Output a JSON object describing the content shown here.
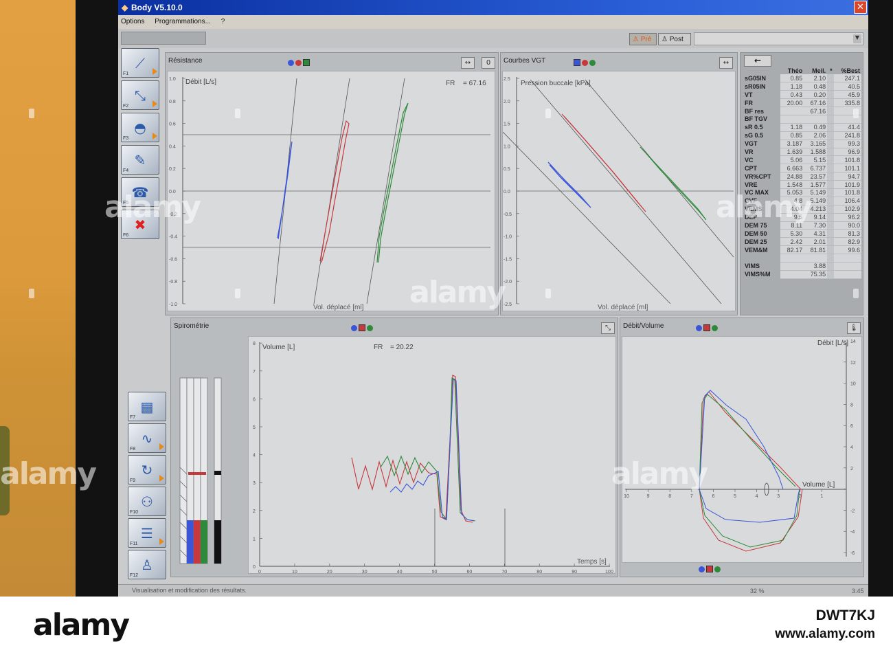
{
  "window": {
    "title": "Body V5.10.0"
  },
  "menu": [
    "Options",
    "Programmations...",
    "?"
  ],
  "toolbar": {
    "pre_label": "Pré",
    "post_label": "Post"
  },
  "fkeys_top": [
    "F1",
    "F2",
    "F3",
    "F4",
    "F5",
    "F6"
  ],
  "fkeys_bottom": [
    "F7",
    "F8",
    "F9",
    "F10",
    "F11",
    "F12"
  ],
  "fkey_icons": [
    "resistance-loop-icon",
    "vgt-curve-icon",
    "flow-volume-icon",
    "asc-icon",
    "phone-icon",
    "tools-cancel-icon",
    "calculator-icon",
    "sine-wave-icon",
    "repeat-cycle-icon",
    "graph-points-icon",
    "report-list-icon",
    "person-tools-icon"
  ],
  "resistance": {
    "title": "Résistance",
    "ylabel": "Débit [L/s]",
    "xlabel": "Vol. déplacé [ml]",
    "fr_label": "FR",
    "fr_value": "= 67.16",
    "yticks": [
      "1.0",
      "0.8",
      "0.6",
      "0.4",
      "0.2",
      "0.0",
      "-0.2",
      "-0.4",
      "-0.6",
      "-0.8",
      "-1.0"
    ]
  },
  "vgt": {
    "title": "Courbes VGT",
    "ylabel": "Pression buccale [kPa]",
    "xlabel": "Vol. déplacé [ml]",
    "yticks": [
      "2.5",
      "2.0",
      "1.5",
      "1.0",
      "0.5",
      "0.0",
      "-0.5",
      "-1.0",
      "-1.5",
      "-2.0",
      "-2.5"
    ]
  },
  "spirometry": {
    "title": "Spirométrie",
    "ylabel": "Volume [L]",
    "xlabel": "Temps [s]",
    "fr_label": "FR",
    "fr_value": "= 20.22",
    "yticks": [
      "0",
      "1",
      "2",
      "3",
      "4",
      "5",
      "6",
      "7",
      "8",
      "9"
    ],
    "xticks": [
      "0",
      "10",
      "20",
      "30",
      "40",
      "50",
      "60",
      "70",
      "80",
      "90",
      "100"
    ]
  },
  "flow_volume": {
    "title": "Débit/Volume",
    "ylabel": "Débit [L/s]",
    "xlabel": "Volume [L]",
    "yticks": [
      "14",
      "12",
      "10",
      "8",
      "6",
      "4",
      "2",
      "",
      "-2",
      "-4",
      "-6"
    ],
    "xticks": [
      "10",
      "9",
      "8",
      "7",
      "6",
      "5",
      "4",
      "3",
      "2",
      "1"
    ]
  },
  "results": {
    "headers": [
      "",
      "Théo",
      "Meil.",
      "*",
      "%Best"
    ],
    "rows": [
      [
        "sG05IN",
        "0.85",
        "2.10",
        "",
        "247.1"
      ],
      [
        "sR05IN",
        "1.18",
        "0.48",
        "",
        "40.5"
      ],
      [
        "VT",
        "0.43",
        "0.20",
        "",
        "45.9"
      ],
      [
        "FR",
        "20.00",
        "67.16",
        "",
        "335.8"
      ],
      [
        "BF res",
        "",
        "67.16",
        "",
        ""
      ],
      [
        "BF TGV",
        "",
        "",
        "",
        ""
      ],
      [
        "sR 0.5",
        "1.18",
        "0.49",
        "",
        "41.4"
      ],
      [
        "sG 0.5",
        "0.85",
        "2.06",
        "",
        "241.8"
      ],
      [
        "VGT",
        "3.187",
        "3.165",
        "",
        "99.3"
      ],
      [
        "VR",
        "1.639",
        "1.588",
        "",
        "96.9"
      ],
      [
        "VC",
        "5.06",
        "5.15",
        "",
        "101.8"
      ],
      [
        "CPT",
        "6.663",
        "6.737",
        "",
        "101.1"
      ],
      [
        "VR%CPT",
        "24.88",
        "23.57",
        "",
        "94.7"
      ],
      [
        "VRE",
        "1.548",
        "1.577",
        "",
        "101.9"
      ],
      [
        "VC MAX",
        "5.053",
        "5.149",
        "",
        "101.8"
      ],
      [
        "CVF",
        "4.8",
        "5.149",
        "",
        "106.4"
      ],
      [
        "VEMS",
        "4.04",
        "4.213",
        "",
        "102.9"
      ],
      [
        "DEP",
        "9.5",
        "9.14",
        "",
        "96.2"
      ],
      [
        "DEM 75",
        "8.11",
        "7.30",
        "",
        "90.0"
      ],
      [
        "DEM 50",
        "5.30",
        "4.31",
        "",
        "81.3"
      ],
      [
        "DEM 25",
        "2.42",
        "2.01",
        "",
        "82.9"
      ],
      [
        "VEM&M",
        "82.17",
        "81.81",
        "",
        "99.6"
      ],
      [
        "",
        "",
        "",
        "",
        ""
      ],
      [
        "VIMS",
        "",
        "3.88",
        "",
        ""
      ],
      [
        "VIMS%M",
        "",
        "75.35",
        "",
        ""
      ]
    ]
  },
  "status": {
    "message": "Visualisation et modification des résultats.",
    "zoom": "32 %",
    "time": "3:45"
  },
  "photo": {
    "brand": "alamy",
    "image_id": "DWT7KJ",
    "site": "www.alamy.com",
    "watermark": "alamy"
  },
  "colors": {
    "blue": "#3a55d8",
    "red": "#c8373c",
    "green": "#2e8a3a",
    "title_bar": "#1b45c0"
  }
}
